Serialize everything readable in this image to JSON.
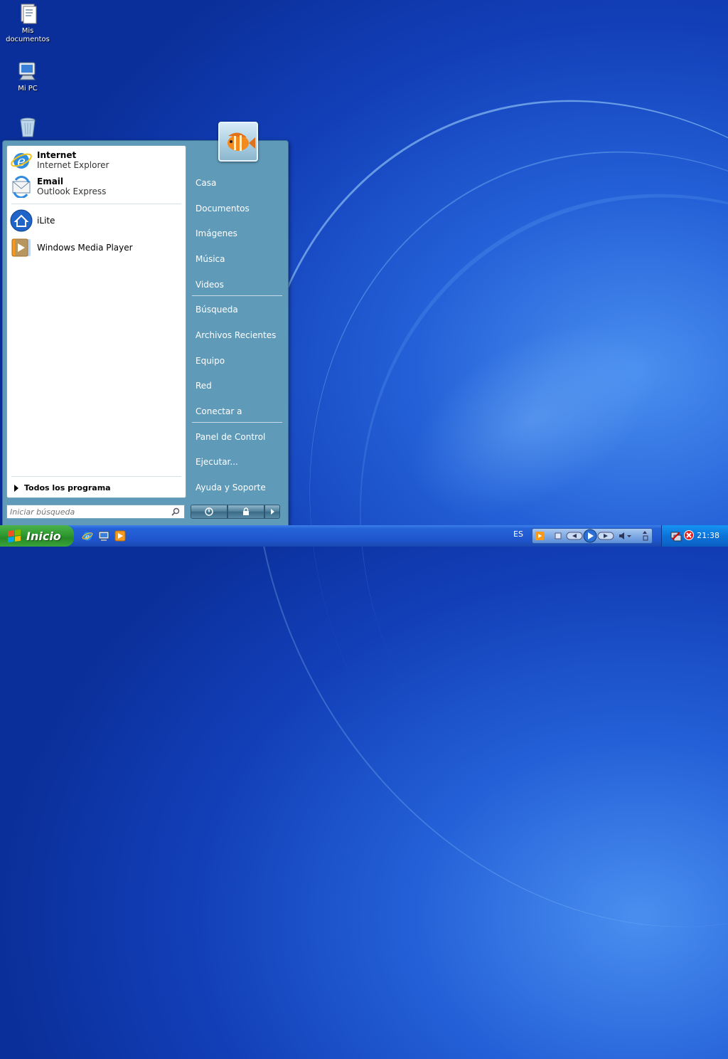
{
  "desktop": {
    "icons": [
      {
        "label": "Mis documentos",
        "icon": "documents-folder-icon"
      },
      {
        "label": "Mi PC",
        "icon": "computer-icon"
      },
      {
        "label": "",
        "icon": "recycle-bin-icon"
      }
    ]
  },
  "start_menu": {
    "pinned": [
      {
        "title": "Internet",
        "subtitle": "Internet Explorer",
        "icon": "internet-explorer-icon"
      },
      {
        "title": "Email",
        "subtitle": "Outlook Express",
        "icon": "outlook-express-icon"
      }
    ],
    "recent": [
      {
        "label": "iLite",
        "icon": "ilite-home-icon"
      },
      {
        "label": "Windows Media Player",
        "icon": "media-player-icon"
      }
    ],
    "all_programs": "Todos los programa",
    "search_placeholder": "Iniciar búsqueda",
    "places": {
      "group1": [
        "Casa",
        "Documentos",
        "Imágenes",
        "Música",
        "Videos"
      ],
      "group2": [
        "Búsqueda",
        "Archivos Recientes",
        "Equipo",
        "Red",
        "Conectar a"
      ],
      "group3": [
        "Panel de Control",
        "Ejecutar...",
        "Ayuda y Soporte"
      ]
    }
  },
  "taskbar": {
    "start_label": "Inicio",
    "language": "ES",
    "clock": "21:38"
  },
  "colors": {
    "accent": "#2461d8",
    "start_green": "#2f9a2f",
    "menu_blue": "#5f9ab8"
  }
}
